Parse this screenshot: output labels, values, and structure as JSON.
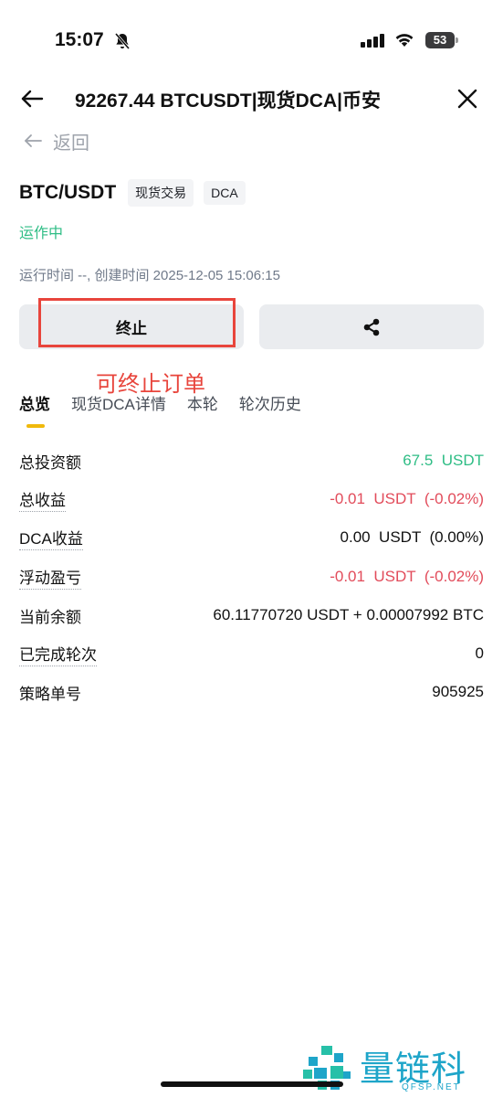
{
  "status": {
    "time": "15:07",
    "battery": "53"
  },
  "header": {
    "title": "92267.44 BTCUSDT|现货DCA|币安"
  },
  "back": {
    "label": "返回"
  },
  "pair": {
    "name": "BTC/USDT",
    "tags": [
      "现货交易",
      "DCA"
    ]
  },
  "state": "运作中",
  "run_time": "运行时间 --, 创建时间 2025-12-05 15:06:15",
  "buttons": {
    "stop_label": "终止"
  },
  "annotation": "可终止订单",
  "tabs": [
    "总览",
    "现货DCA详情",
    "本轮",
    "轮次历史"
  ],
  "rows": [
    {
      "label": "总投资额",
      "value": "67.5  USDT"
    },
    {
      "label": "总收益",
      "value": "-0.01  USDT  (-0.02%)"
    },
    {
      "label": "DCA收益",
      "value": "0.00  USDT  (0.00%)"
    },
    {
      "label": "浮动盈亏",
      "value": "-0.01  USDT  (-0.02%)"
    },
    {
      "label": "当前余额",
      "value": "60.11770720 USDT + 0.00007992 BTC"
    },
    {
      "label": "已完成轮次",
      "value": "0"
    },
    {
      "label": "策略单号",
      "value": "905925"
    }
  ],
  "colors": {
    "positive": "#2ebd85",
    "negative": "#e24c5b",
    "accent": "#f0b90b",
    "annotation": "#e8453c"
  },
  "watermark": {
    "name": "量链科技",
    "domain": "QFSP.NET"
  }
}
